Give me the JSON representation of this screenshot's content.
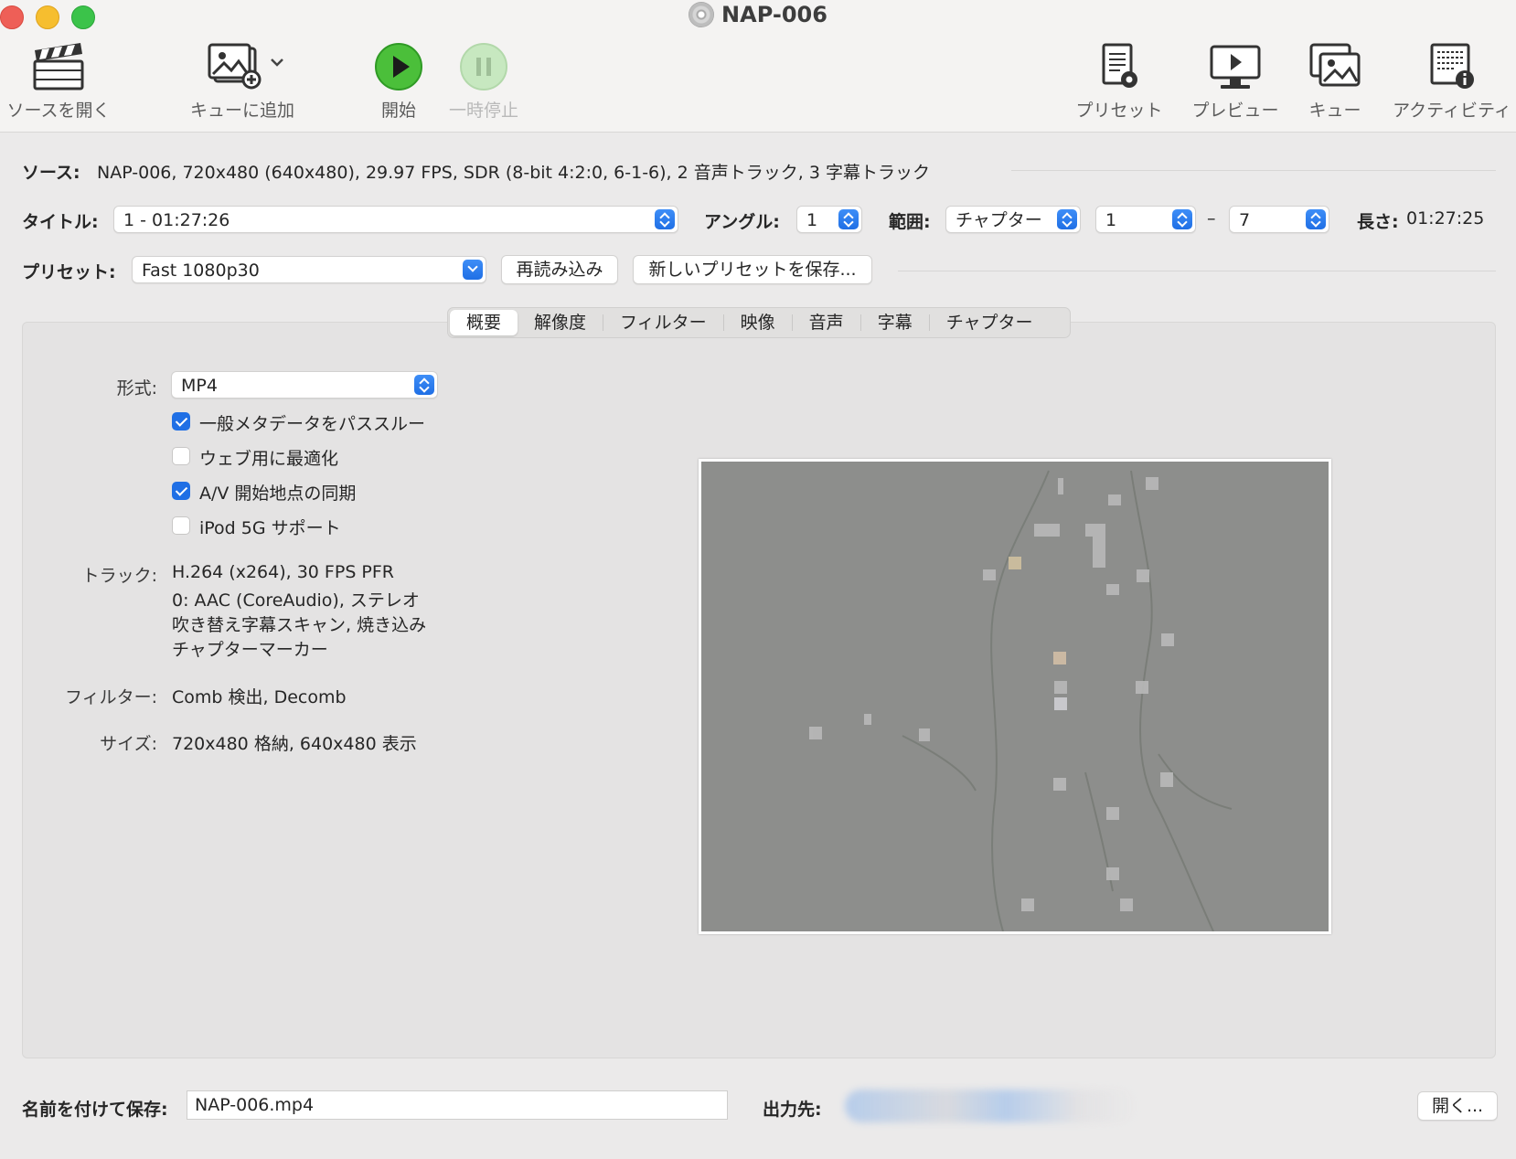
{
  "window": {
    "title": "NAP-006"
  },
  "toolbar": {
    "open_source": "ソースを開く",
    "add_to_queue": "キューに追加",
    "start": "開始",
    "pause": "一時停止",
    "presets": "プリセット",
    "preview": "プレビュー",
    "queue": "キュー",
    "activity": "アクティビティ"
  },
  "source": {
    "label": "ソース:",
    "value": "NAP-006, 720x480 (640x480), 29.97 FPS, SDR (8-bit 4:2:0, 6-1-6), 2 音声トラック, 3 字幕トラック"
  },
  "title_row": {
    "title_label": "タイトル:",
    "title_value": "1 - 01:27:26",
    "angle_label": "アングル:",
    "angle_value": "1",
    "range_label": "範囲:",
    "range_type": "チャプター",
    "range_start": "1",
    "range_dash": "–",
    "range_end": "7",
    "duration_label": "長さ:",
    "duration_value": "01:27:25"
  },
  "preset_row": {
    "label": "プリセット:",
    "value": "Fast 1080p30",
    "reload": "再読み込み",
    "save_new": "新しいプリセットを保存..."
  },
  "tabs": [
    "概要",
    "解像度",
    "フィルター",
    "映像",
    "音声",
    "字幕",
    "チャプター"
  ],
  "summary": {
    "format_label": "形式:",
    "format_value": "MP4",
    "checks": [
      {
        "label": "一般メタデータをパススルー",
        "checked": true
      },
      {
        "label": "ウェブ用に最適化",
        "checked": false
      },
      {
        "label": "A/V 開始地点の同期",
        "checked": true
      },
      {
        "label": "iPod 5G サポート",
        "checked": false
      }
    ],
    "tracks_label": "トラック:",
    "tracks": [
      "H.264 (x264), 30 FPS PFR",
      "0: AAC (CoreAudio), ステレオ",
      "吹き替え字幕スキャン, 焼き込み",
      "チャプターマーカー"
    ],
    "filters_label": "フィルター:",
    "filters_value": "Comb 検出, Decomb",
    "size_label": "サイズ:",
    "size_value": "720x480 格納, 640x480 表示"
  },
  "footer": {
    "save_as_label": "名前を付けて保存:",
    "save_as_value": "NAP-006.mp4",
    "dest_label": "出力先:",
    "open_button": "開く..."
  },
  "colors": {
    "accent": "#1f6fe5",
    "start_green": "#4bbf3a",
    "close_red": "#ee5f57",
    "minimize_yellow": "#f6be2f",
    "zoom_green": "#3bc34a"
  }
}
